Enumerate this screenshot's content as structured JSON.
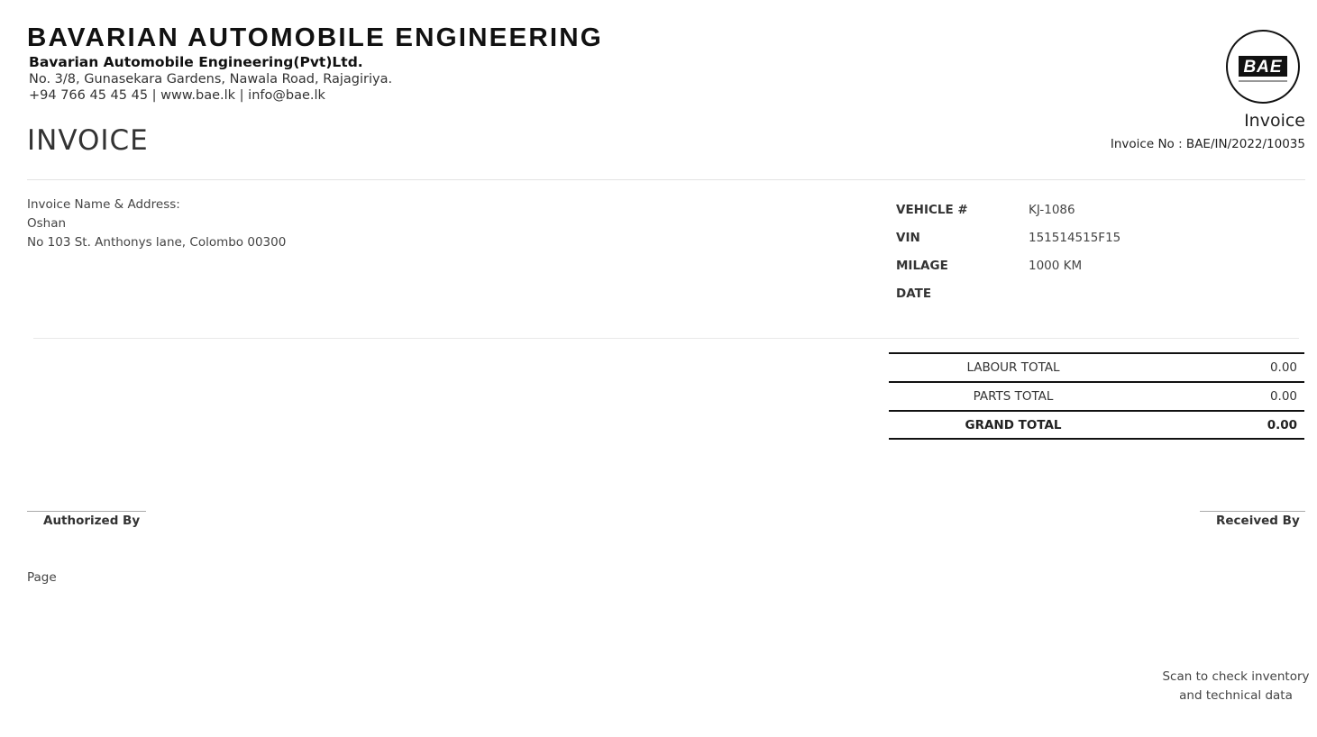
{
  "header": {
    "company_name": "BAVARIAN AUTOMOBILE ENGINEERING",
    "legal_name": "Bavarian Automobile Engineering(Pvt)Ltd.",
    "address": "No. 3/8, Gunasekara Gardens, Nawala Road, Rajagiriya.",
    "contact": "+94 766 45 45 45  |  www.bae.lk  |   info@bae.lk",
    "logo_text": "BAE",
    "document_type": "Invoice",
    "invoice_number": "Invoice No : BAE/IN/2022/10035"
  },
  "page_title": "INVOICE",
  "billing": {
    "caption": "Invoice Name & Address:",
    "name": "Oshan",
    "address": "No 103 St. Anthonys lane, Colombo 00300"
  },
  "vehicle": [
    {
      "label": "VEHICLE #",
      "value": "KJ-1086"
    },
    {
      "label": "VIN",
      "value": "151514515F15"
    },
    {
      "label": "MILAGE",
      "value": "1000 KM"
    },
    {
      "label": "DATE",
      "value": ""
    }
  ],
  "totals": [
    {
      "label": "LABOUR TOTAL",
      "value": "0.00"
    },
    {
      "label": "PARTS TOTAL",
      "value": "0.00"
    },
    {
      "label": "GRAND TOTAL",
      "value": "0.00"
    }
  ],
  "signatures": {
    "authorized": "Authorized By",
    "received": "Received By"
  },
  "footer": {
    "page_label": "Page",
    "scan_note": "Scan to check inventory and technical data"
  },
  "colors": {
    "text": "#333333",
    "rule": "#111111",
    "divider": "#e3e3e3"
  }
}
